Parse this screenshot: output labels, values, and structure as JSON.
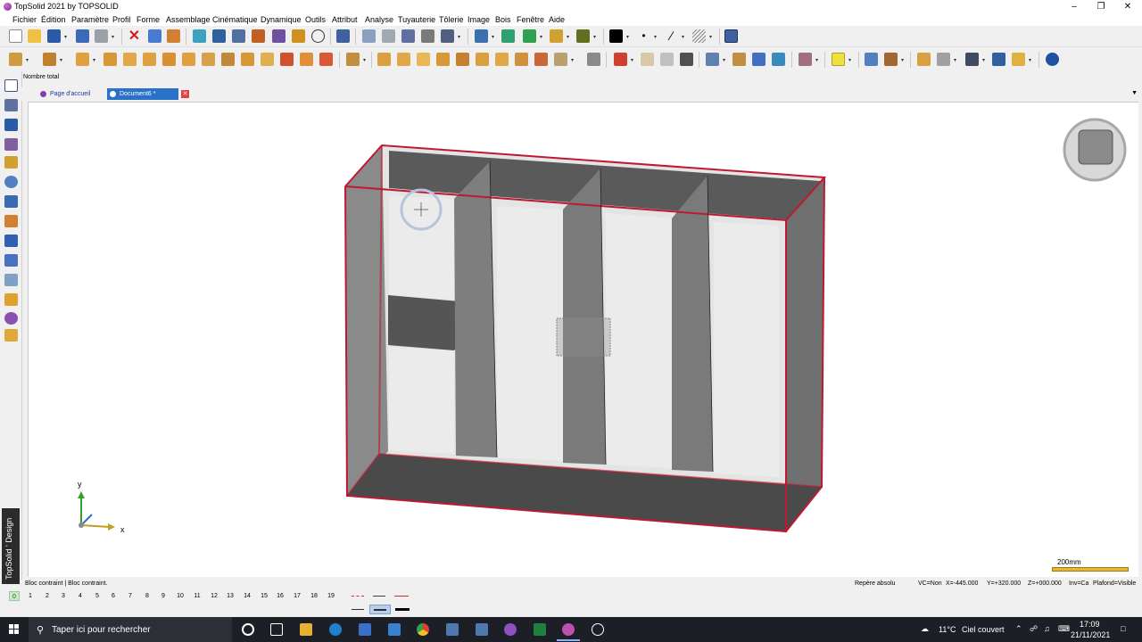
{
  "window": {
    "title": "TopSolid 2021 by TOPSOLID"
  },
  "menu": [
    "Fichier",
    "Édition",
    "Paramètre",
    "Profil",
    "Forme",
    "Assemblage",
    "Cinématique",
    "Dynamique",
    "Outils",
    "Attribut",
    "Analyse",
    "Tuyauterie",
    "Tôlerie",
    "Image",
    "Bois",
    "Fenêtre",
    "Aide"
  ],
  "input_row": {
    "label": "Nombre total",
    "value": ""
  },
  "tabs": [
    {
      "label": "Page d'accueil",
      "active": false
    },
    {
      "label": "Document6 *",
      "active": true
    }
  ],
  "sidebar_brand": "TopSolid ' Design",
  "viewport": {
    "axis_y_label": "y",
    "axis_x_label": "x",
    "scale_label": "200mm"
  },
  "status": {
    "left": "Bloc contraint | Bloc contraint.",
    "frame": "Repère absolu",
    "vc": "VC=Non",
    "x": "X=-445.000",
    "y": "Y=+320.000",
    "z": "Z=+000.000",
    "inv": "Inv=Ca",
    "plafond": "Plafond=Visible"
  },
  "layers": [
    "0",
    "1",
    "2",
    "3",
    "4",
    "5",
    "6",
    "7",
    "8",
    "9",
    "10",
    "11",
    "12",
    "13",
    "14",
    "15",
    "16",
    "17",
    "18",
    "19"
  ],
  "active_layer": "0",
  "colors": {
    "selection_red": "#c01830",
    "active_tab": "#2a72c8",
    "scale_bar": "#e8b830"
  },
  "taskbar": {
    "search_placeholder": "Taper ici pour rechercher",
    "weather_temp": "11°C",
    "weather_text": "Ciel couvert",
    "time": "17:09",
    "date": "21/11/2021"
  }
}
